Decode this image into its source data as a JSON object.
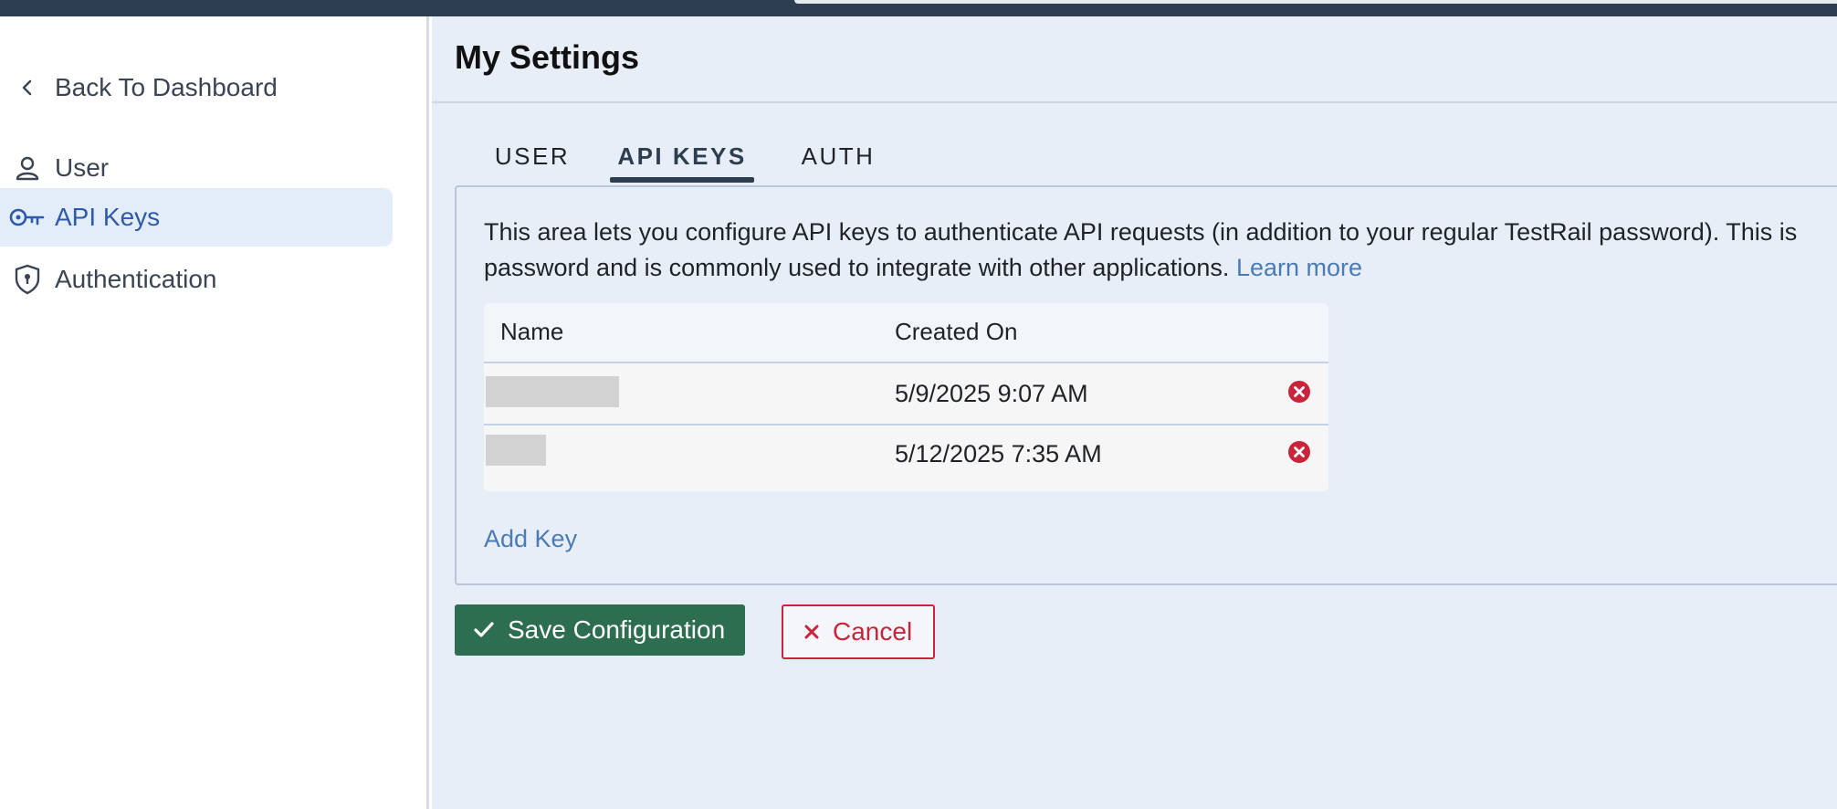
{
  "sidebar": {
    "back_label": "Back To Dashboard",
    "items": [
      {
        "label": "User",
        "icon": "user-icon"
      },
      {
        "label": "API Keys",
        "icon": "key-icon"
      },
      {
        "label": "Authentication",
        "icon": "shield-lock-icon"
      }
    ],
    "active_index": 1
  },
  "header": {
    "title": "My Settings"
  },
  "tabs": [
    {
      "label": "USER"
    },
    {
      "label": "API KEYS"
    },
    {
      "label": "AUTH"
    }
  ],
  "active_tab": 1,
  "panel": {
    "description_line1": "This area lets you configure API keys to authenticate API requests (in addition to your regular TestRail password). This is",
    "description_line2": "password and is commonly used to integrate with other applications.",
    "learn_more": "Learn more",
    "table": {
      "columns": [
        "Name",
        "Created On"
      ],
      "rows": [
        {
          "name": "",
          "created_on": "5/9/2025 9:07 AM"
        },
        {
          "name": "",
          "created_on": "5/12/2025 7:35 AM"
        }
      ]
    },
    "add_key_label": "Add Key"
  },
  "actions": {
    "save_label": "Save Configuration",
    "cancel_label": "Cancel"
  },
  "colors": {
    "save_bg": "#2d6e50",
    "cancel_red": "#c8243c",
    "link_blue": "#4a7bb6",
    "active_blue": "#2f5aa8",
    "dark_slate": "#2c3e50"
  }
}
